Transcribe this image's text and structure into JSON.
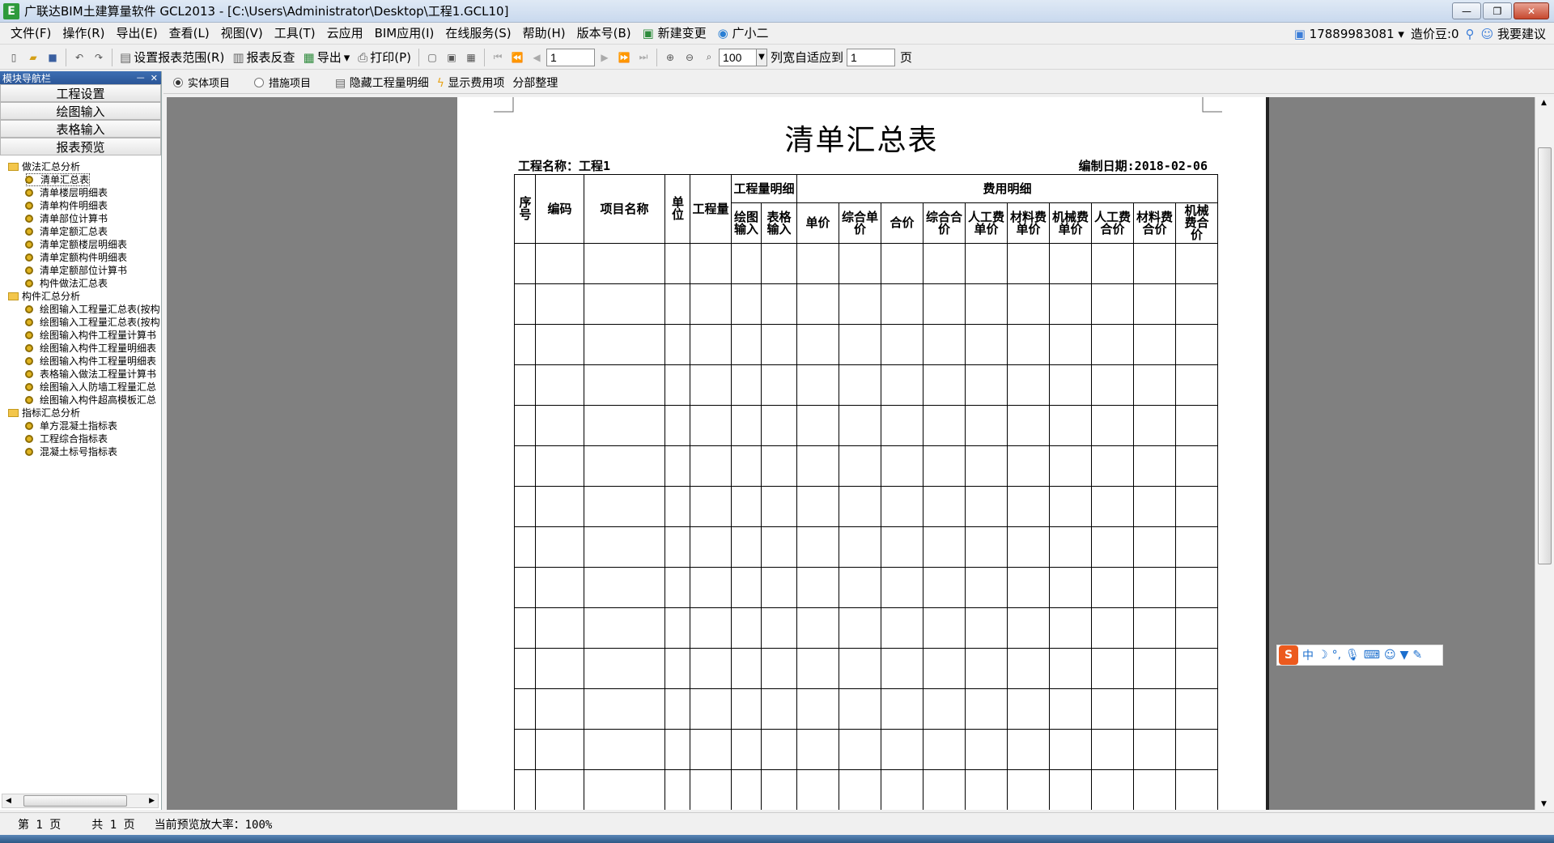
{
  "window": {
    "icon_letter": "E",
    "title": "广联达BIM土建算量软件 GCL2013 - [C:\\Users\\Administrator\\Desktop\\工程1.GCL10]",
    "minimize": "—",
    "restore": "❐",
    "close": "✕"
  },
  "menu": {
    "items": [
      "文件(F)",
      "操作(R)",
      "导出(E)",
      "查看(L)",
      "视图(V)",
      "工具(T)",
      "云应用",
      "BIM应用(I)",
      "在线服务(S)",
      "帮助(H)",
      "版本号(B)",
      "新建变更",
      "广小二"
    ],
    "user_id": "17889983081",
    "cost_beans": "造价豆:0",
    "suggest": "我要建议"
  },
  "toolbar": {
    "set_range": "设置报表范围(R)",
    "report_check": "报表反查",
    "export": "导出",
    "print": "打印(P)",
    "page_value": "1",
    "zoom_value": "100",
    "fit_label": "列宽自适应到",
    "fit_value": "1",
    "page_unit": "页"
  },
  "sidebar": {
    "header": "模块导航栏",
    "pin": "ᅳ",
    "close": "✕",
    "nav_buttons": [
      "工程设置",
      "绘图输入",
      "表格输入",
      "报表预览"
    ],
    "tree": [
      {
        "group": "做法汇总分析",
        "items": [
          "清单汇总表",
          "清单楼层明细表",
          "清单构件明细表",
          "清单部位计算书",
          "清单定额汇总表",
          "清单定额楼层明细表",
          "清单定额构件明细表",
          "清单定额部位计算书",
          "构件做法汇总表"
        ]
      },
      {
        "group": "构件汇总分析",
        "items": [
          "绘图输入工程量汇总表(按构",
          "绘图输入工程量汇总表(按构",
          "绘图输入构件工程量计算书",
          "绘图输入构件工程量明细表",
          "绘图输入构件工程量明细表",
          "表格输入做法工程量计算书",
          "绘图输入人防墙工程量汇总",
          "绘图输入构件超高模板汇总"
        ]
      },
      {
        "group": "指标汇总分析",
        "items": [
          "单方混凝土指标表",
          "工程综合指标表",
          "混凝土标号指标表"
        ]
      }
    ]
  },
  "options": {
    "radio_entity": "实体项目",
    "radio_measure": "措施项目",
    "hide_detail": "隐藏工程量明细",
    "show_fee": "显示费用项",
    "sort_section": "分部整理"
  },
  "report": {
    "title": "清单汇总表",
    "project_name": "工程名称：工程1",
    "date": "编制日期:2018-02-06",
    "headers": {
      "seq": "序号",
      "code": "编码",
      "name": "项目名称",
      "unit": "单位",
      "qty": "工程量",
      "qty_detail": "工程量明细",
      "draw_input": "绘图输入",
      "table_input": "表格输入",
      "fee_detail": "费用明细",
      "unit_price": "单价",
      "comp_unit_price": "综合单价",
      "total": "合价",
      "comp_total": "综合合价",
      "labor_unit": "人工费单价",
      "material_unit": "材料费单价",
      "machine_unit": "机械费单价",
      "labor_total": "人工费合价",
      "material_total": "材料费合价",
      "machine_total": "机械费合价"
    },
    "empty_rows": 14
  },
  "ime": {
    "logo": "S",
    "mode": "中"
  },
  "status": {
    "page": "第 1 页",
    "total": "共 1 页",
    "zoom": "当前预览放大率：100%"
  }
}
